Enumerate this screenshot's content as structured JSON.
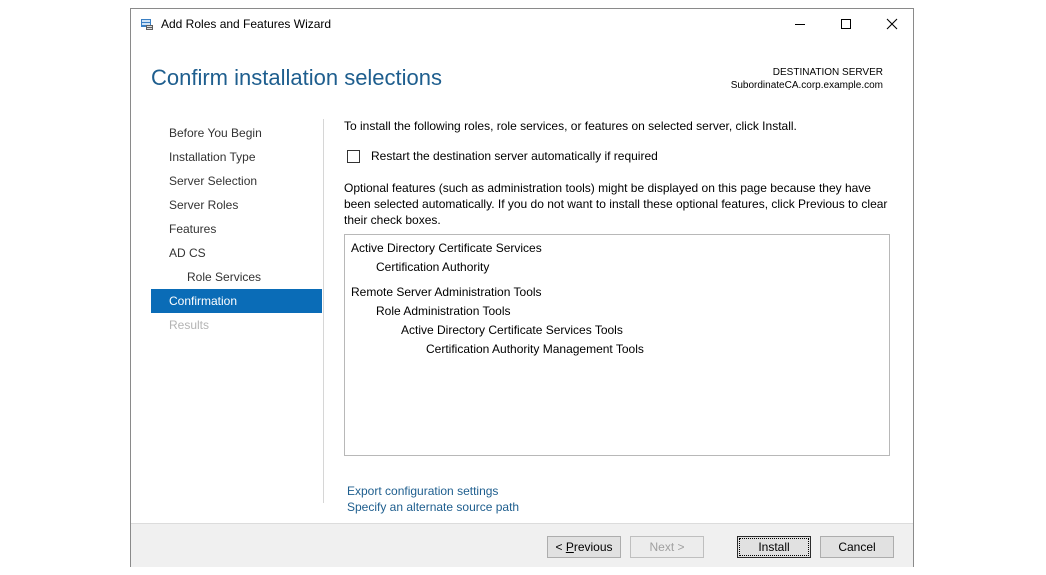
{
  "window": {
    "title": "Add Roles and Features Wizard",
    "icon": "server-manager-icon"
  },
  "page": {
    "heading": "Confirm installation selections",
    "destination_label": "DESTINATION SERVER",
    "destination_server": "SubordinateCA.corp.example.com"
  },
  "nav": {
    "items": [
      {
        "label": "Before You Begin"
      },
      {
        "label": "Installation Type"
      },
      {
        "label": "Server Selection"
      },
      {
        "label": "Server Roles"
      },
      {
        "label": "Features"
      },
      {
        "label": "AD CS"
      },
      {
        "label": "Role Services"
      },
      {
        "label": "Confirmation"
      },
      {
        "label": "Results"
      }
    ]
  },
  "content": {
    "intro": "To install the following roles, role services, or features on selected server, click Install.",
    "restart_checkbox_label": "Restart the destination server automatically if required",
    "restart_checked": false,
    "note": "Optional features (such as administration tools) might be displayed on this page because they have been selected automatically. If you do not want to install these optional features, click Previous to clear their check boxes.",
    "selections": [
      {
        "label": "Active Directory Certificate Services"
      },
      {
        "label": "Certification Authority"
      },
      {
        "label": "Remote Server Administration Tools"
      },
      {
        "label": "Role Administration Tools"
      },
      {
        "label": "Active Directory Certificate Services Tools"
      },
      {
        "label": "Certification Authority Management Tools"
      }
    ],
    "export_link": "Export configuration settings",
    "alternate_source_link": "Specify an alternate source path"
  },
  "footer": {
    "previous": {
      "mnemonic": "P",
      "rest": "revious",
      "prefix": "< "
    },
    "next": "Next >",
    "install": "Install",
    "cancel": "Cancel"
  }
}
